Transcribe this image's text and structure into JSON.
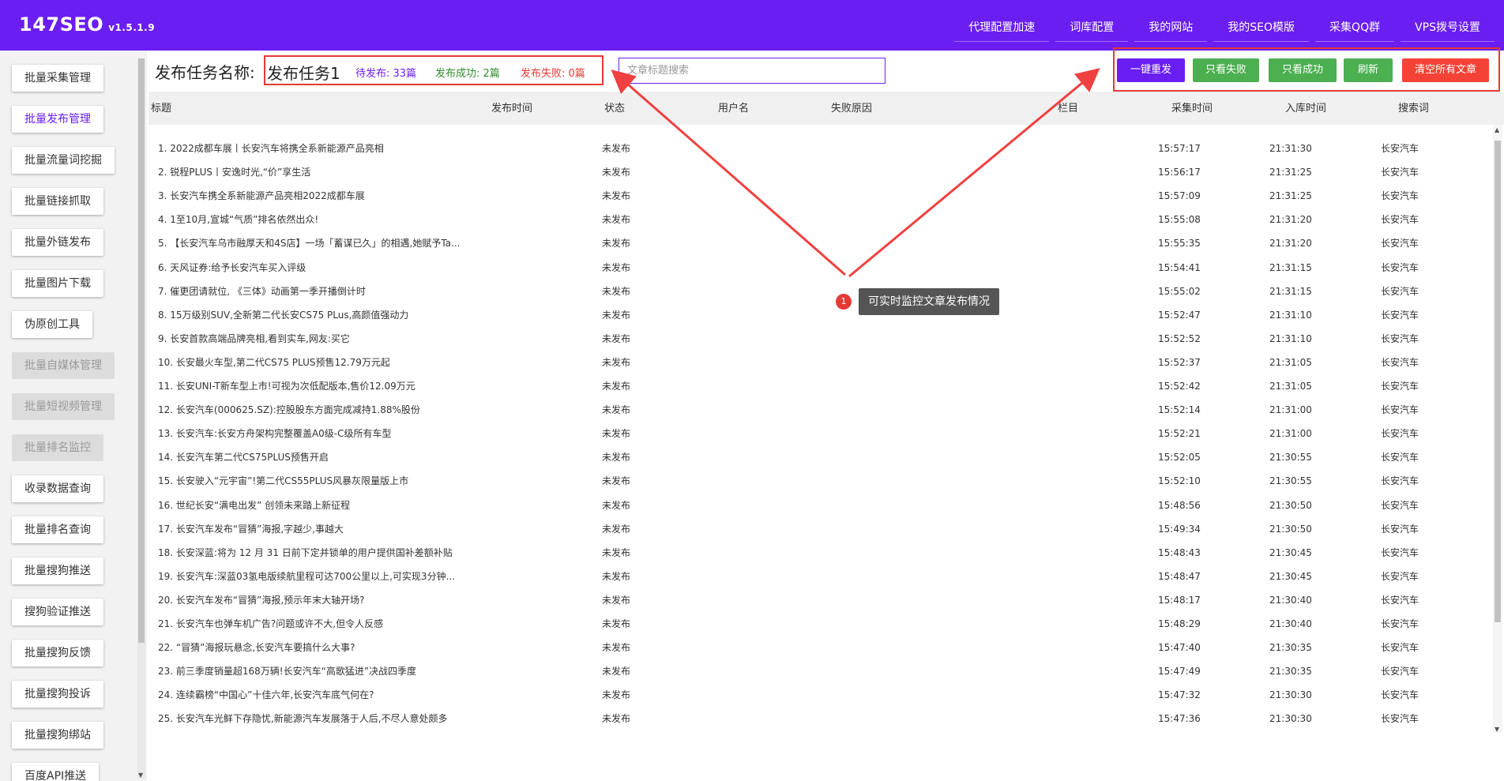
{
  "header": {
    "brand": "147SEO",
    "version": "v1.5.1.9",
    "nav": [
      "代理配置加速",
      "词库配置",
      "我的网站",
      "我的SEO模版",
      "采集QQ群",
      "VPS拨号设置"
    ]
  },
  "sidebar": {
    "items": [
      {
        "label": "批量采集管理",
        "state": "normal"
      },
      {
        "label": "批量发布管理",
        "state": "active"
      },
      {
        "label": "批量流量词挖掘",
        "state": "normal"
      },
      {
        "label": "批量链接抓取",
        "state": "normal"
      },
      {
        "label": "批量外链发布",
        "state": "normal"
      },
      {
        "label": "批量图片下载",
        "state": "normal"
      },
      {
        "label": "伪原创工具",
        "state": "normal"
      },
      {
        "label": "批量自媒体管理",
        "state": "disabled"
      },
      {
        "label": "批量短视频管理",
        "state": "disabled"
      },
      {
        "label": "批量排名监控",
        "state": "disabled"
      },
      {
        "label": "收录数据查询",
        "state": "normal"
      },
      {
        "label": "批量排名查询",
        "state": "normal"
      },
      {
        "label": "批量搜狗推送",
        "state": "normal"
      },
      {
        "label": "搜狗验证推送",
        "state": "normal"
      },
      {
        "label": "批量搜狗反馈",
        "state": "normal"
      },
      {
        "label": "批量搜狗投诉",
        "state": "normal"
      },
      {
        "label": "批量搜狗绑站",
        "state": "normal"
      },
      {
        "label": "百度API推送",
        "state": "normal"
      }
    ]
  },
  "task": {
    "label": "发布任务名称:",
    "name": "发布任务1",
    "pending": "待发布: 33篇",
    "success": "发布成功: 2篇",
    "failed": "发布失败: 0篇"
  },
  "search": {
    "placeholder": "文章标题搜索",
    "value": ""
  },
  "actions": {
    "republish": "一键重发",
    "only_failed": "只看失败",
    "only_success": "只看成功",
    "refresh": "刷新",
    "clear_all": "清空所有文章"
  },
  "table": {
    "columns": [
      "标题",
      "发布时间",
      "状态",
      "用户名",
      "失败原因",
      "栏目",
      "采集时间",
      "入库时间",
      "搜索词"
    ],
    "rows": [
      {
        "title": "1. 2022成都车展丨长安汽车将携全系新能源产品亮相",
        "status": "未发布",
        "collect": "15:57:17",
        "store": "21:31:30",
        "kw": "长安汽车"
      },
      {
        "title": "2. 锐程PLUS丨安逸时光,“价”享生活",
        "status": "未发布",
        "collect": "15:56:17",
        "store": "21:31:25",
        "kw": "长安汽车"
      },
      {
        "title": "3. 长安汽车携全系新能源产品亮相2022成都车展",
        "status": "未发布",
        "collect": "15:57:09",
        "store": "21:31:25",
        "kw": "长安汽车"
      },
      {
        "title": "4. 1至10月,宣城“气质”排名依然出众!",
        "status": "未发布",
        "collect": "15:55:08",
        "store": "21:31:20",
        "kw": "长安汽车"
      },
      {
        "title": "5. 【长安汽车乌市融厚天和4S店】一场「蓄谋已久」的相遇,她赋予Ta...",
        "status": "未发布",
        "collect": "15:55:35",
        "store": "21:31:20",
        "kw": "长安汽车"
      },
      {
        "title": "6. 天风证券:给予长安汽车买入评级",
        "status": "未发布",
        "collect": "15:54:41",
        "store": "21:31:15",
        "kw": "长安汽车"
      },
      {
        "title": "7. 催更团请就位, 《三体》动画第一季开播倒计时",
        "status": "未发布",
        "collect": "15:55:02",
        "store": "21:31:15",
        "kw": "长安汽车"
      },
      {
        "title": "8. 15万级别SUV,全新第二代长安CS75 PLus,高颜值强动力",
        "status": "未发布",
        "collect": "15:52:47",
        "store": "21:31:10",
        "kw": "长安汽车"
      },
      {
        "title": "9. 长安首款高端品牌亮相,看到实车,网友:买它",
        "status": "未发布",
        "collect": "15:52:52",
        "store": "21:31:10",
        "kw": "长安汽车"
      },
      {
        "title": "10. 长安最火车型,第二代CS75 PLUS预售12.79万元起",
        "status": "未发布",
        "collect": "15:52:37",
        "store": "21:31:05",
        "kw": "长安汽车"
      },
      {
        "title": "11. 长安UNI-T新车型上市!可视为次低配版本,售价12.09万元",
        "status": "未发布",
        "collect": "15:52:42",
        "store": "21:31:05",
        "kw": "长安汽车"
      },
      {
        "title": "12. 长安汽车(000625.SZ):控股股东方面完成减持1.88%股份",
        "status": "未发布",
        "collect": "15:52:14",
        "store": "21:31:00",
        "kw": "长安汽车"
      },
      {
        "title": "13. 长安汽车:长安方舟架构完整覆盖A0级-C级所有车型",
        "status": "未发布",
        "collect": "15:52:21",
        "store": "21:31:00",
        "kw": "长安汽车"
      },
      {
        "title": "14. 长安汽车第二代CS75PLUS预售开启",
        "status": "未发布",
        "collect": "15:52:05",
        "store": "21:30:55",
        "kw": "长安汽车"
      },
      {
        "title": "15. 长安驶入“元宇宙”!第二代CS55PLUS风暴灰限量版上市",
        "status": "未发布",
        "collect": "15:52:10",
        "store": "21:30:55",
        "kw": "长安汽车"
      },
      {
        "title": "16. 世纪长安“满电出发” 创领未来踏上新征程",
        "status": "未发布",
        "collect": "15:48:56",
        "store": "21:30:50",
        "kw": "长安汽车"
      },
      {
        "title": "17. 长安汽车发布“冒猜”海报,字越少,事越大",
        "status": "未发布",
        "collect": "15:49:34",
        "store": "21:30:50",
        "kw": "长安汽车"
      },
      {
        "title": "18. 长安深蓝:将为 12 月 31 日前下定并锁单的用户提供国补差额补贴",
        "status": "未发布",
        "collect": "15:48:43",
        "store": "21:30:45",
        "kw": "长安汽车"
      },
      {
        "title": "19. 长安汽车:深蓝03氢电版续航里程可达700公里以上,可实现3分钟...",
        "status": "未发布",
        "collect": "15:48:47",
        "store": "21:30:45",
        "kw": "长安汽车"
      },
      {
        "title": "20. 长安汽车发布“冒猜”海报,预示年末大轴开场?",
        "status": "未发布",
        "collect": "15:48:17",
        "store": "21:30:40",
        "kw": "长安汽车"
      },
      {
        "title": "21. 长安汽车也弹车机广告?问题或许不大,但令人反感",
        "status": "未发布",
        "collect": "15:48:29",
        "store": "21:30:40",
        "kw": "长安汽车"
      },
      {
        "title": "22. “冒猜”海报玩悬念,长安汽车要搞什么大事?",
        "status": "未发布",
        "collect": "15:47:40",
        "store": "21:30:35",
        "kw": "长安汽车"
      },
      {
        "title": "23. 前三季度销量超168万辆!长安汽车“高歌猛进”决战四季度",
        "status": "未发布",
        "collect": "15:47:49",
        "store": "21:30:35",
        "kw": "长安汽车"
      },
      {
        "title": "24. 连续霸榜“中国心”十佳六年,长安汽车底气何在?",
        "status": "未发布",
        "collect": "15:47:32",
        "store": "21:30:30",
        "kw": "长安汽车"
      },
      {
        "title": "25. 长安汽车光鲜下存隐忧,新能源汽车发展落于人后,不尽人意处颇多",
        "status": "未发布",
        "collect": "15:47:36",
        "store": "21:30:30",
        "kw": "长安汽车"
      }
    ]
  },
  "annotation": {
    "badge": "1",
    "text": "可实时监控文章发布情况"
  },
  "colors": {
    "brand": "#6a1ef2",
    "success": "#4caf50",
    "danger": "#f44336",
    "highlight": "#e53935"
  }
}
